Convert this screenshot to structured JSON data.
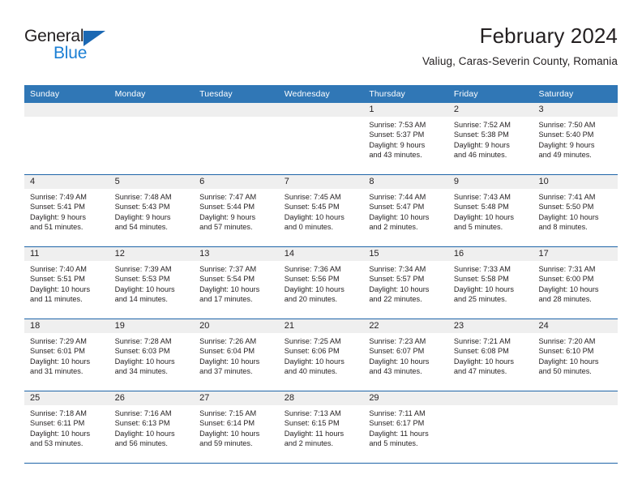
{
  "brand": {
    "name_top": "General",
    "name_bottom": "Blue",
    "triangle_icon": "brand-triangle-icon",
    "color_dark": "#231f20",
    "color_blue": "#1b7fd4"
  },
  "header": {
    "title": "February 2024",
    "subtitle": "Valiug, Caras-Severin County, Romania"
  },
  "theme": {
    "header_bg": "#3077b6",
    "row_rule": "#1f65a8",
    "day_band_bg": "#efefef",
    "cell_bg": "#ffffff",
    "text": "#231f20"
  },
  "weekday_headers": [
    "Sunday",
    "Monday",
    "Tuesday",
    "Wednesday",
    "Thursday",
    "Friday",
    "Saturday"
  ],
  "weeks": [
    [
      {
        "day": "",
        "empty": true,
        "sunrise": "",
        "sunset": "",
        "daylight_line1": "",
        "daylight_line2": ""
      },
      {
        "day": "",
        "empty": true,
        "sunrise": "",
        "sunset": "",
        "daylight_line1": "",
        "daylight_line2": ""
      },
      {
        "day": "",
        "empty": true,
        "sunrise": "",
        "sunset": "",
        "daylight_line1": "",
        "daylight_line2": ""
      },
      {
        "day": "",
        "empty": true,
        "sunrise": "",
        "sunset": "",
        "daylight_line1": "",
        "daylight_line2": ""
      },
      {
        "day": "1",
        "empty": false,
        "sunrise": "Sunrise: 7:53 AM",
        "sunset": "Sunset: 5:37 PM",
        "daylight_line1": "Daylight: 9 hours",
        "daylight_line2": "and 43 minutes."
      },
      {
        "day": "2",
        "empty": false,
        "sunrise": "Sunrise: 7:52 AM",
        "sunset": "Sunset: 5:38 PM",
        "daylight_line1": "Daylight: 9 hours",
        "daylight_line2": "and 46 minutes."
      },
      {
        "day": "3",
        "empty": false,
        "sunrise": "Sunrise: 7:50 AM",
        "sunset": "Sunset: 5:40 PM",
        "daylight_line1": "Daylight: 9 hours",
        "daylight_line2": "and 49 minutes."
      }
    ],
    [
      {
        "day": "4",
        "empty": false,
        "sunrise": "Sunrise: 7:49 AM",
        "sunset": "Sunset: 5:41 PM",
        "daylight_line1": "Daylight: 9 hours",
        "daylight_line2": "and 51 minutes."
      },
      {
        "day": "5",
        "empty": false,
        "sunrise": "Sunrise: 7:48 AM",
        "sunset": "Sunset: 5:43 PM",
        "daylight_line1": "Daylight: 9 hours",
        "daylight_line2": "and 54 minutes."
      },
      {
        "day": "6",
        "empty": false,
        "sunrise": "Sunrise: 7:47 AM",
        "sunset": "Sunset: 5:44 PM",
        "daylight_line1": "Daylight: 9 hours",
        "daylight_line2": "and 57 minutes."
      },
      {
        "day": "7",
        "empty": false,
        "sunrise": "Sunrise: 7:45 AM",
        "sunset": "Sunset: 5:45 PM",
        "daylight_line1": "Daylight: 10 hours",
        "daylight_line2": "and 0 minutes."
      },
      {
        "day": "8",
        "empty": false,
        "sunrise": "Sunrise: 7:44 AM",
        "sunset": "Sunset: 5:47 PM",
        "daylight_line1": "Daylight: 10 hours",
        "daylight_line2": "and 2 minutes."
      },
      {
        "day": "9",
        "empty": false,
        "sunrise": "Sunrise: 7:43 AM",
        "sunset": "Sunset: 5:48 PM",
        "daylight_line1": "Daylight: 10 hours",
        "daylight_line2": "and 5 minutes."
      },
      {
        "day": "10",
        "empty": false,
        "sunrise": "Sunrise: 7:41 AM",
        "sunset": "Sunset: 5:50 PM",
        "daylight_line1": "Daylight: 10 hours",
        "daylight_line2": "and 8 minutes."
      }
    ],
    [
      {
        "day": "11",
        "empty": false,
        "sunrise": "Sunrise: 7:40 AM",
        "sunset": "Sunset: 5:51 PM",
        "daylight_line1": "Daylight: 10 hours",
        "daylight_line2": "and 11 minutes."
      },
      {
        "day": "12",
        "empty": false,
        "sunrise": "Sunrise: 7:39 AM",
        "sunset": "Sunset: 5:53 PM",
        "daylight_line1": "Daylight: 10 hours",
        "daylight_line2": "and 14 minutes."
      },
      {
        "day": "13",
        "empty": false,
        "sunrise": "Sunrise: 7:37 AM",
        "sunset": "Sunset: 5:54 PM",
        "daylight_line1": "Daylight: 10 hours",
        "daylight_line2": "and 17 minutes."
      },
      {
        "day": "14",
        "empty": false,
        "sunrise": "Sunrise: 7:36 AM",
        "sunset": "Sunset: 5:56 PM",
        "daylight_line1": "Daylight: 10 hours",
        "daylight_line2": "and 20 minutes."
      },
      {
        "day": "15",
        "empty": false,
        "sunrise": "Sunrise: 7:34 AM",
        "sunset": "Sunset: 5:57 PM",
        "daylight_line1": "Daylight: 10 hours",
        "daylight_line2": "and 22 minutes."
      },
      {
        "day": "16",
        "empty": false,
        "sunrise": "Sunrise: 7:33 AM",
        "sunset": "Sunset: 5:58 PM",
        "daylight_line1": "Daylight: 10 hours",
        "daylight_line2": "and 25 minutes."
      },
      {
        "day": "17",
        "empty": false,
        "sunrise": "Sunrise: 7:31 AM",
        "sunset": "Sunset: 6:00 PM",
        "daylight_line1": "Daylight: 10 hours",
        "daylight_line2": "and 28 minutes."
      }
    ],
    [
      {
        "day": "18",
        "empty": false,
        "sunrise": "Sunrise: 7:29 AM",
        "sunset": "Sunset: 6:01 PM",
        "daylight_line1": "Daylight: 10 hours",
        "daylight_line2": "and 31 minutes."
      },
      {
        "day": "19",
        "empty": false,
        "sunrise": "Sunrise: 7:28 AM",
        "sunset": "Sunset: 6:03 PM",
        "daylight_line1": "Daylight: 10 hours",
        "daylight_line2": "and 34 minutes."
      },
      {
        "day": "20",
        "empty": false,
        "sunrise": "Sunrise: 7:26 AM",
        "sunset": "Sunset: 6:04 PM",
        "daylight_line1": "Daylight: 10 hours",
        "daylight_line2": "and 37 minutes."
      },
      {
        "day": "21",
        "empty": false,
        "sunrise": "Sunrise: 7:25 AM",
        "sunset": "Sunset: 6:06 PM",
        "daylight_line1": "Daylight: 10 hours",
        "daylight_line2": "and 40 minutes."
      },
      {
        "day": "22",
        "empty": false,
        "sunrise": "Sunrise: 7:23 AM",
        "sunset": "Sunset: 6:07 PM",
        "daylight_line1": "Daylight: 10 hours",
        "daylight_line2": "and 43 minutes."
      },
      {
        "day": "23",
        "empty": false,
        "sunrise": "Sunrise: 7:21 AM",
        "sunset": "Sunset: 6:08 PM",
        "daylight_line1": "Daylight: 10 hours",
        "daylight_line2": "and 47 minutes."
      },
      {
        "day": "24",
        "empty": false,
        "sunrise": "Sunrise: 7:20 AM",
        "sunset": "Sunset: 6:10 PM",
        "daylight_line1": "Daylight: 10 hours",
        "daylight_line2": "and 50 minutes."
      }
    ],
    [
      {
        "day": "25",
        "empty": false,
        "sunrise": "Sunrise: 7:18 AM",
        "sunset": "Sunset: 6:11 PM",
        "daylight_line1": "Daylight: 10 hours",
        "daylight_line2": "and 53 minutes."
      },
      {
        "day": "26",
        "empty": false,
        "sunrise": "Sunrise: 7:16 AM",
        "sunset": "Sunset: 6:13 PM",
        "daylight_line1": "Daylight: 10 hours",
        "daylight_line2": "and 56 minutes."
      },
      {
        "day": "27",
        "empty": false,
        "sunrise": "Sunrise: 7:15 AM",
        "sunset": "Sunset: 6:14 PM",
        "daylight_line1": "Daylight: 10 hours",
        "daylight_line2": "and 59 minutes."
      },
      {
        "day": "28",
        "empty": false,
        "sunrise": "Sunrise: 7:13 AM",
        "sunset": "Sunset: 6:15 PM",
        "daylight_line1": "Daylight: 11 hours",
        "daylight_line2": "and 2 minutes."
      },
      {
        "day": "29",
        "empty": false,
        "sunrise": "Sunrise: 7:11 AM",
        "sunset": "Sunset: 6:17 PM",
        "daylight_line1": "Daylight: 11 hours",
        "daylight_line2": "and 5 minutes."
      },
      {
        "day": "",
        "empty": true,
        "sunrise": "",
        "sunset": "",
        "daylight_line1": "",
        "daylight_line2": ""
      },
      {
        "day": "",
        "empty": true,
        "sunrise": "",
        "sunset": "",
        "daylight_line1": "",
        "daylight_line2": ""
      }
    ]
  ]
}
